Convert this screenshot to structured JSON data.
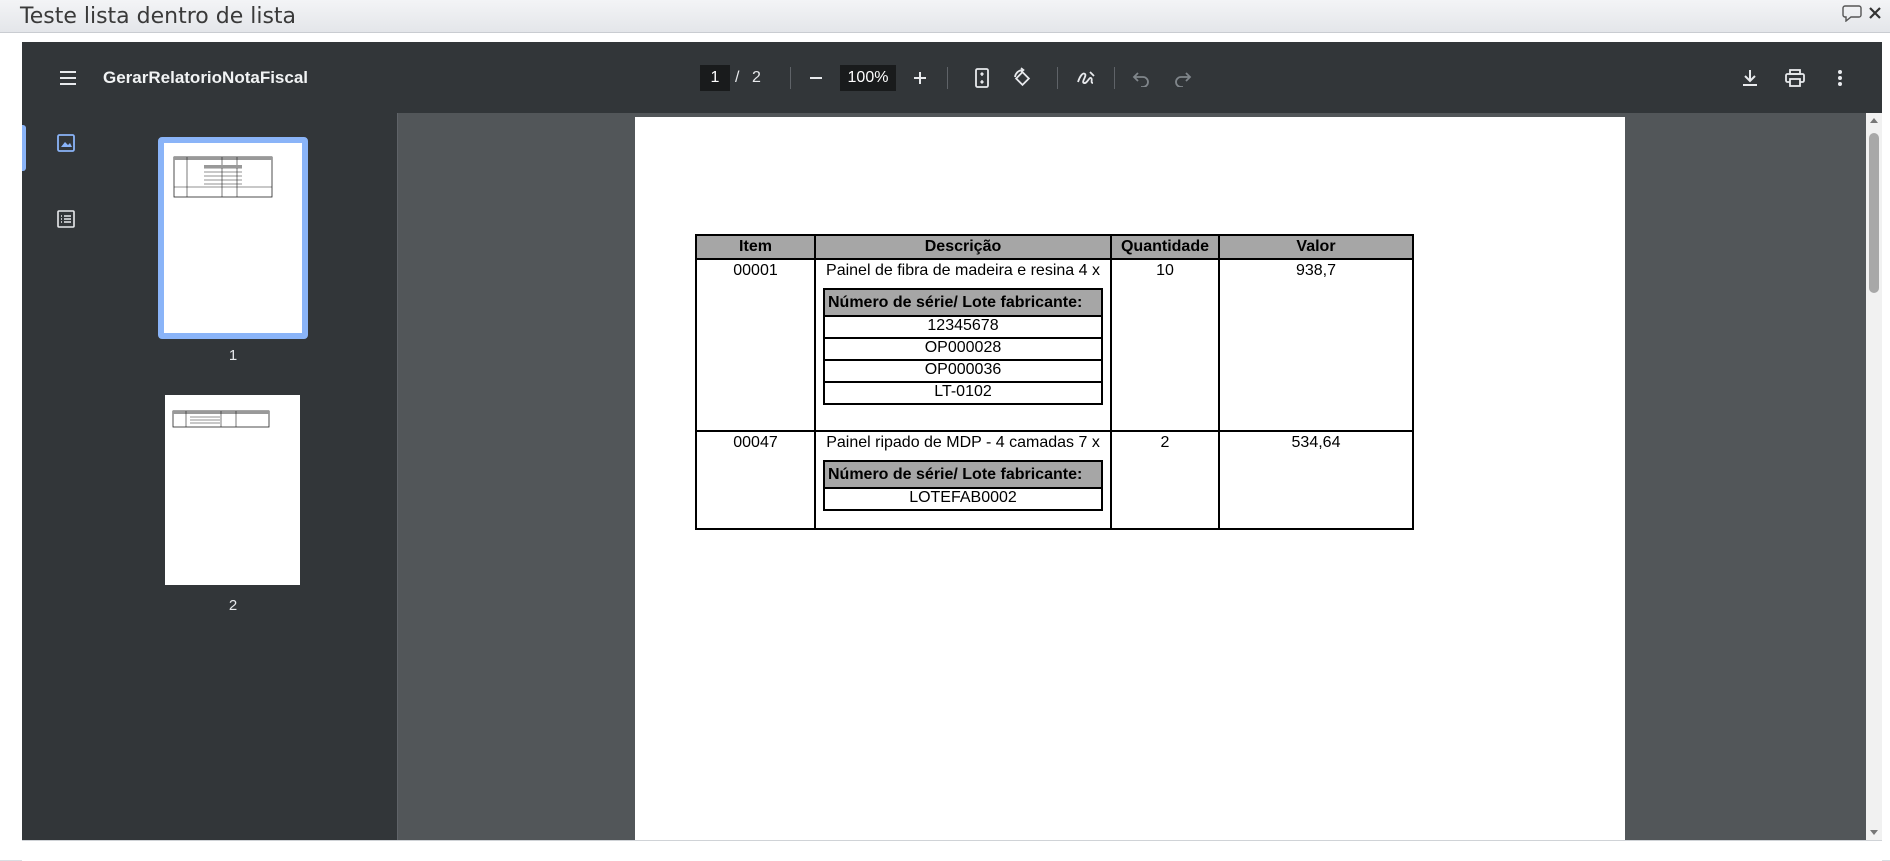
{
  "dialog": {
    "title": "Teste lista dentro de lista"
  },
  "toolbar": {
    "doc_title": "GerarRelatorioNotaFiscal",
    "current_page": "1",
    "page_separator": "/",
    "total_pages": "2",
    "zoom": "100%"
  },
  "sidebar": {
    "thumbs": [
      {
        "label": "1",
        "selected": true
      },
      {
        "label": "2",
        "selected": false
      }
    ]
  },
  "document": {
    "headers": [
      "Item",
      "Descrição",
      "Quantidade",
      "Valor"
    ],
    "serial_header": "Número de série/ Lote fabricante:",
    "rows": [
      {
        "item": "00001",
        "description": "Painel de fibra de madeira e resina 4 x",
        "quantity": "10",
        "value": "938,7",
        "serials": [
          "12345678",
          "OP000028",
          "OP000036",
          "LT-0102"
        ]
      },
      {
        "item": "00047",
        "description": "Painel ripado de MDP - 4 camadas 7 x",
        "quantity": "2",
        "value": "534,64",
        "serials": [
          "LOTEFAB0002"
        ]
      }
    ]
  },
  "colors": {
    "toolbar_bg": "#323639",
    "viewer_bg": "#525659",
    "accent": "#8ab4f8",
    "table_header_bg": "#a6a6a6"
  }
}
